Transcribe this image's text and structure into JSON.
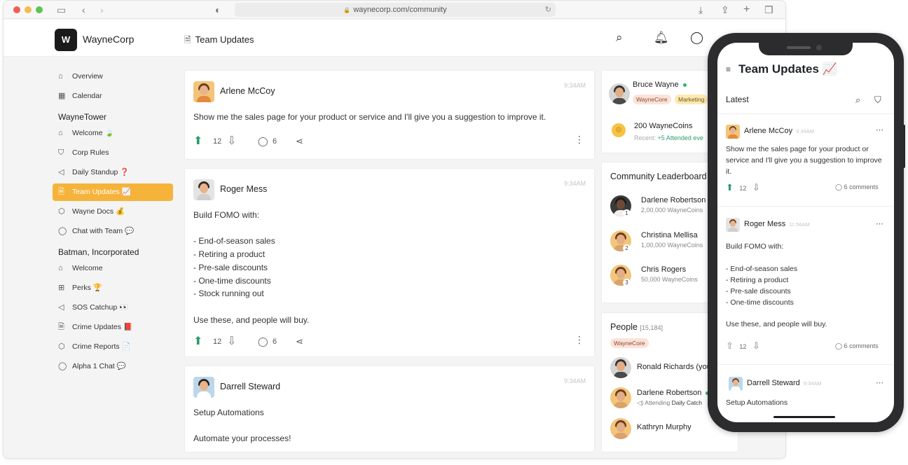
{
  "browser": {
    "url": "waynecorp.com/community"
  },
  "header": {
    "logo_text": "W",
    "brand": "WayneCorp",
    "page_title": "Team Updates"
  },
  "sidebar": {
    "top_items": [
      {
        "label": "Overview",
        "icon": "home-icon"
      },
      {
        "label": "Calendar",
        "icon": "calendar-icon"
      }
    ],
    "section1": {
      "title": "WayneTower",
      "items": [
        {
          "label": "Welcome 🍃",
          "icon": "home-icon"
        },
        {
          "label": "Corp Rules",
          "icon": "shield-icon"
        },
        {
          "label": "Daily Standup ❓",
          "icon": "speaker-icon"
        },
        {
          "label": "Team Updates 📈",
          "icon": "document-icon",
          "active": true
        },
        {
          "label": "Wayne Docs 💰",
          "icon": "cube-icon"
        },
        {
          "label": "Chat with Team 💬",
          "icon": "chat-icon"
        }
      ]
    },
    "section2": {
      "title": "Batman, Incorporated",
      "items": [
        {
          "label": "Welcome",
          "icon": "home-icon"
        },
        {
          "label": "Perks 🏆",
          "icon": "gift-icon"
        },
        {
          "label": "SOS Catchup 👀",
          "icon": "speaker-icon"
        },
        {
          "label": "Crime Updates 📕",
          "icon": "document-icon"
        },
        {
          "label": "Crime Reports 📄",
          "icon": "cube-icon"
        },
        {
          "label": "Alpha 1 Chat 💬",
          "icon": "chat-icon"
        }
      ]
    }
  },
  "feed": {
    "posts": [
      {
        "author": "Arlene McCoy",
        "time": "9:34AM",
        "body": "Show me the sales page for your product or service and I'll give you a suggestion to improve it.",
        "upvotes": "12",
        "comments": "6"
      },
      {
        "author": "Roger Mess",
        "time": "9:34AM",
        "body": "Build FOMO with:\n\n- End-of-season sales\n- Retiring a product\n- Pre-sale discounts\n- One-time discounts\n- Stock running out\n\nUse these, and people will buy.",
        "upvotes": "12",
        "comments": "6"
      },
      {
        "author": "Darrell Steward",
        "time": "9:34AM",
        "body": "Setup Automations\n\nAutomate your processes!"
      }
    ]
  },
  "profile": {
    "name": "Bruce Wayne",
    "tags": [
      "WayneCore",
      "Marketing"
    ],
    "coins": "200 WayneCoins",
    "recent_label": "Recent:",
    "recent_value": "+5 Attended eve"
  },
  "leaderboard": {
    "title": "Community Leaderboard",
    "entries": [
      {
        "rank": "1",
        "name": "Darlene Robertson",
        "coins": "2,00,000 WayneCoins"
      },
      {
        "rank": "2",
        "name": "Christina Mellisa",
        "coins": "1,00,000 WayneCoins"
      },
      {
        "rank": "3",
        "name": "Chris Rogers",
        "coins": "50,000 WayneCoins"
      }
    ]
  },
  "people": {
    "title": "People",
    "count": "[15,184]",
    "filter_tag": "WayneCore",
    "list": [
      {
        "name": "Ronald Richards (you)"
      },
      {
        "name": "Darlene Robertson",
        "status_prefix": "Attending",
        "status_value": "Daily Catch"
      },
      {
        "name": "Kathryn Murphy"
      }
    ]
  },
  "mobile": {
    "title": "Team Updates 📈",
    "filter": "Latest",
    "posts": [
      {
        "author": "Arlene McCoy",
        "time": "9:34AM",
        "body": "Show me the sales page for your product or service and I'll give you a suggestion to improve it.",
        "upvotes": "12",
        "comments": "6 comments"
      },
      {
        "author": "Roger Mess",
        "time": "11:56AM",
        "body": "Build FOMO with:\n\n- End-of-season sales\n- Retiring a product\n- Pre-sale discounts\n- One-time discounts\n\nUse these, and people will buy.",
        "upvotes": "12",
        "comments": "6 comments"
      },
      {
        "author": "Darrell Steward",
        "time": "9:34AM",
        "body": "Setup Automations"
      }
    ]
  },
  "colors": {
    "accent": "#f6b33a",
    "upvote": "#2e9b6b",
    "online": "#2cb66a"
  }
}
